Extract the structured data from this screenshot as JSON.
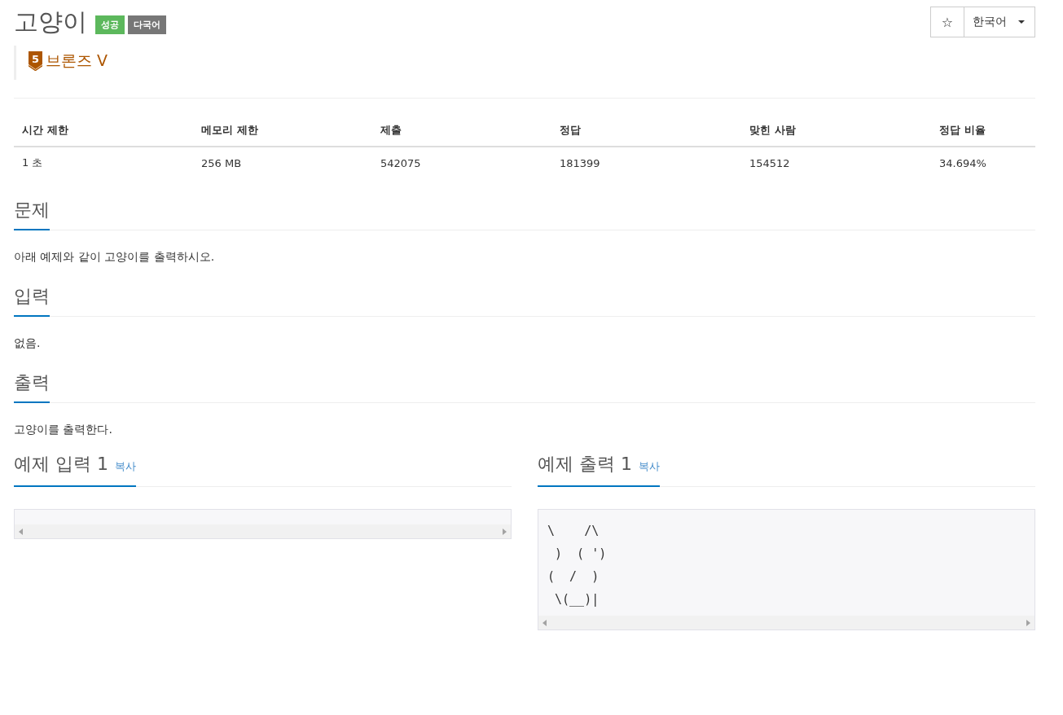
{
  "problem": {
    "title": "고양이",
    "badges": [
      {
        "label": "성공",
        "kind": "success"
      },
      {
        "label": "다국어",
        "kind": "multilang"
      }
    ],
    "tier": {
      "number": "5",
      "label": "브론즈 V"
    }
  },
  "toolbar": {
    "star": "☆",
    "language": "한국어"
  },
  "stats": {
    "columns": [
      "시간 제한",
      "메모리 제한",
      "제출",
      "정답",
      "맞힌 사람",
      "정답 비율"
    ],
    "row": [
      "1 초",
      "256 MB",
      "542075",
      "181399",
      "154512",
      "34.694%"
    ]
  },
  "sections": [
    {
      "heading": "문제",
      "body": "아래 예제와 같이 고양이를 출력하시오."
    },
    {
      "heading": "입력",
      "body": "없음."
    },
    {
      "heading": "출력",
      "body": "고양이를 출력한다."
    }
  ],
  "samples": [
    {
      "heading": "예제 입력 1",
      "copy": "복사"
    },
    {
      "heading": "예제 출력 1",
      "copy": "복사",
      "content": "\\    /\\\n )  ( ')\n(  /  )\n \\(__)|"
    }
  ]
}
